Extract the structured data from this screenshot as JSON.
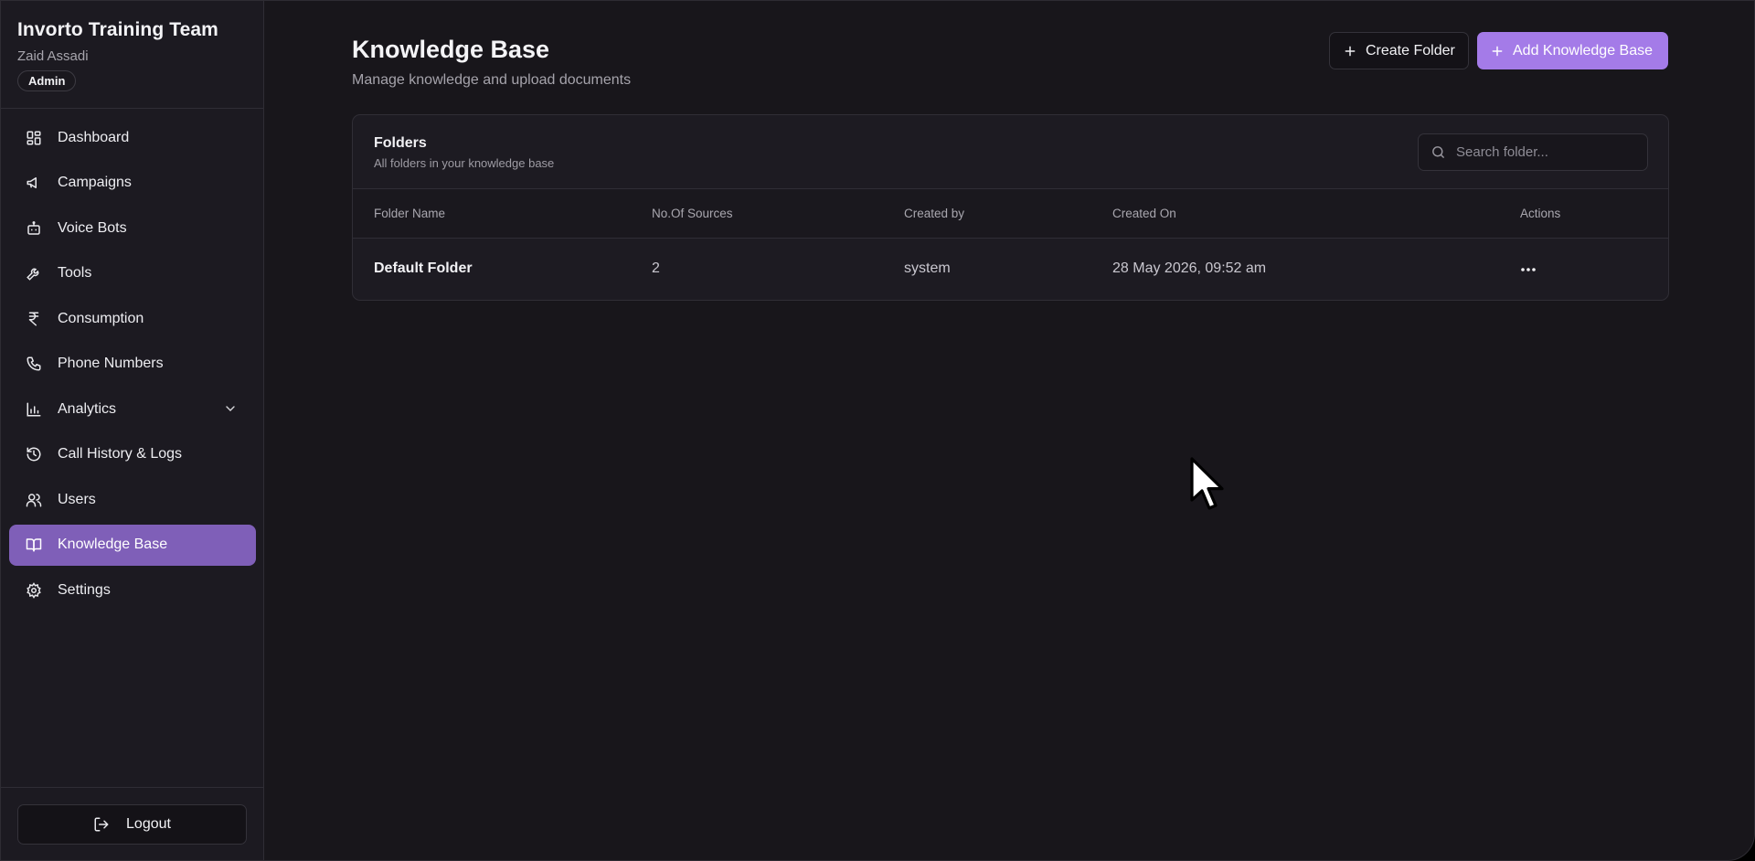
{
  "sidebar": {
    "team_name": "Invorto Training Team",
    "user_name": "Zaid Assadi",
    "role": "Admin",
    "items": [
      {
        "label": "Dashboard",
        "icon": "dashboard-icon"
      },
      {
        "label": "Campaigns",
        "icon": "megaphone-icon"
      },
      {
        "label": "Voice Bots",
        "icon": "bot-icon"
      },
      {
        "label": "Tools",
        "icon": "wrench-icon"
      },
      {
        "label": "Consumption",
        "icon": "rupee-icon"
      },
      {
        "label": "Phone Numbers",
        "icon": "phone-icon"
      },
      {
        "label": "Analytics",
        "icon": "bar-chart-icon",
        "expandable": true
      },
      {
        "label": "Call History & Logs",
        "icon": "history-icon"
      },
      {
        "label": "Users",
        "icon": "users-icon"
      },
      {
        "label": "Knowledge Base",
        "icon": "book-icon",
        "active": true
      },
      {
        "label": "Settings",
        "icon": "gear-icon"
      }
    ],
    "logout_label": "Logout"
  },
  "header": {
    "title": "Knowledge Base",
    "subtitle": "Manage knowledge and upload documents",
    "create_folder_label": "Create Folder",
    "add_kb_label": "Add Knowledge Base"
  },
  "folders_card": {
    "title": "Folders",
    "subtitle": "All folders in your knowledge base",
    "search_placeholder": "Search folder...",
    "columns": [
      "Folder Name",
      "No.Of Sources",
      "Created by",
      "Created On",
      "Actions"
    ],
    "rows": [
      {
        "name": "Default Folder",
        "sources": "2",
        "created_by": "system",
        "created_on": "28 May 2026, 09:52 am"
      }
    ]
  },
  "colors": {
    "background": "#18161b",
    "sidebar": "#1c1a21",
    "accent": "#a47be8",
    "active_nav": "#7f5fb8"
  }
}
